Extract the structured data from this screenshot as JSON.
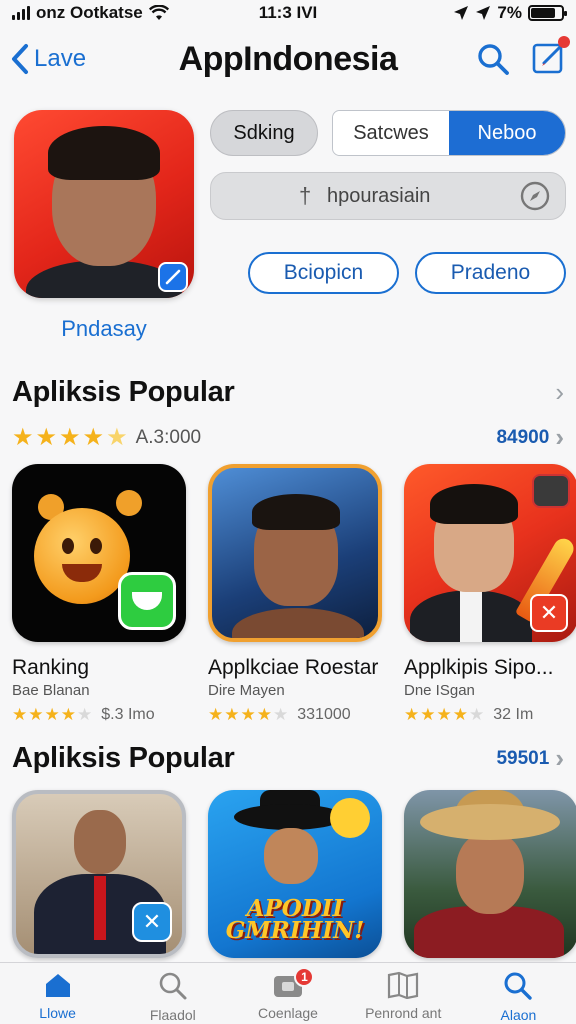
{
  "status_bar": {
    "carrier": "onz Ootkatse",
    "time": "11:3 IVI",
    "battery": "7%",
    "battery_level": 0.8
  },
  "nav": {
    "back_label": "Lave",
    "title": "AppIndonesia"
  },
  "profile": {
    "name": "Pndasay"
  },
  "controls": {
    "sorting_label": "Sdking",
    "segments": [
      "Satcwes",
      "Neboo"
    ],
    "active_segment": 1,
    "search_value": "hpourasiain",
    "button_left": "Bciopicn",
    "button_right": "Pradeno"
  },
  "section1": {
    "title": "Apliksis Popular",
    "rating": 4,
    "rating_text": "A.3:000",
    "count": "84900",
    "apps": [
      {
        "name": "Ranking",
        "developer": "Bae Blanan",
        "stars": 4,
        "rating_text": "$.3 Imo"
      },
      {
        "name": "Applkciae Roestar",
        "developer": "Dire Mayen",
        "stars": 4,
        "rating_text": "331000"
      },
      {
        "name": "Applkipis Sipo...",
        "developer": "Dne ISgan",
        "stars": 4.5,
        "rating_text": "32 Im"
      }
    ]
  },
  "section2": {
    "title": "Apliksis Popular",
    "count": "59501",
    "icon_text": "APODII GMRIHIN!"
  },
  "tabs": [
    {
      "label": "Llowe",
      "icon": "home-icon",
      "active": true
    },
    {
      "label": "Flaadol",
      "icon": "search-icon",
      "active": false
    },
    {
      "label": "Coenlage",
      "icon": "wallet-icon",
      "active": false,
      "badge": "1"
    },
    {
      "label": "Penrond ant",
      "icon": "book-icon",
      "active": false
    },
    {
      "label": "Alaon",
      "icon": "search-icon",
      "active": true
    }
  ],
  "colors": {
    "accent": "#1a6fd1",
    "star": "#f5b21b",
    "badge": "#e53935"
  }
}
